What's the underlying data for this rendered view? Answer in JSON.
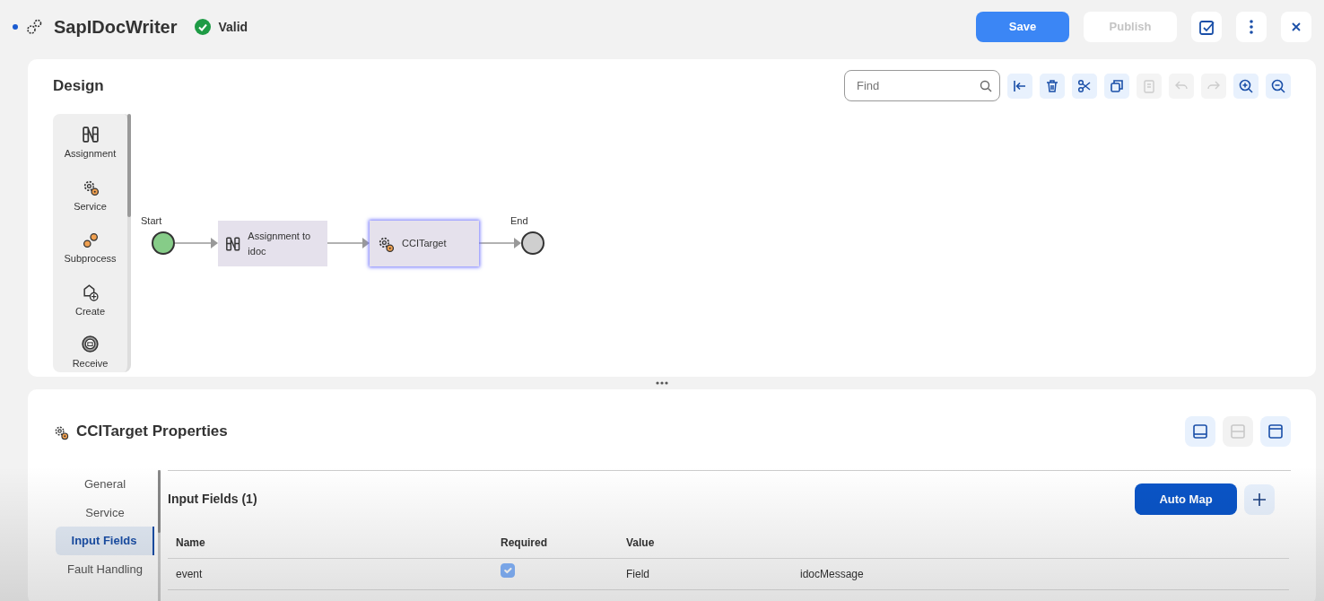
{
  "header": {
    "unsaved": true,
    "title": "SapIDocWriter",
    "status": "Valid",
    "save": "Save",
    "publish": {
      "label": "Publish",
      "disabled": true
    }
  },
  "design": {
    "title": "Design",
    "find": {
      "placeholder": "Find"
    },
    "tools": [
      {
        "disabled": false
      },
      {
        "disabled": false
      },
      {
        "disabled": false
      },
      {
        "disabled": false
      },
      {
        "disabled": true
      },
      {
        "disabled": true
      },
      {
        "disabled": true
      },
      {
        "disabled": false
      },
      {
        "disabled": false
      }
    ],
    "palette": [
      "Assignment",
      "Service",
      "Subprocess",
      "Create",
      "Receive"
    ],
    "nodes": [
      {
        "kind": "start",
        "label": "Start"
      },
      {
        "kind": "assignment",
        "label": "Assignment to idoc",
        "selected": false
      },
      {
        "kind": "service",
        "label": "CCITarget",
        "selected": true
      },
      {
        "kind": "end",
        "label": "End"
      }
    ]
  },
  "properties": {
    "title": "CCITarget Properties",
    "views": [
      {
        "disabled": false
      },
      {
        "disabled": true
      },
      {
        "disabled": false
      }
    ],
    "tabs": [
      {
        "label": "General",
        "selected": false
      },
      {
        "label": "Service",
        "selected": false
      },
      {
        "label": "Input Fields",
        "selected": true
      },
      {
        "label": "Fault Handling",
        "selected": false
      }
    ],
    "section": "Input Fields (1)",
    "auto_map": "Auto Map",
    "columns": [
      "Name",
      "Required",
      "Value"
    ],
    "rows": [
      {
        "name": "event",
        "required": true,
        "value_type": "Field",
        "value": "idocMessage"
      }
    ]
  }
}
